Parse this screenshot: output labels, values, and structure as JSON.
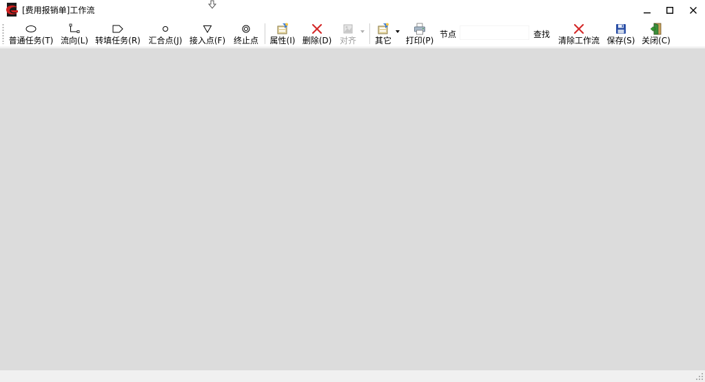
{
  "window": {
    "title": "[费用报销单]工作流",
    "controls": {
      "minimize": "minimize-icon",
      "maximize": "maximize-icon",
      "close": "close-icon"
    }
  },
  "toolbar": {
    "items": [
      {
        "label": "普通任务(T)",
        "icon": "ellipse-icon"
      },
      {
        "label": "流向(L)",
        "icon": "connector-icon"
      },
      {
        "label": "转填任务(R)",
        "icon": "pentagon-tag-icon"
      },
      {
        "label": "汇合点(J)",
        "icon": "small-circle-icon"
      },
      {
        "label": "接入点(F)",
        "icon": "triangle-down-icon"
      },
      {
        "label": "终止点",
        "icon": "double-circle-icon"
      },
      {
        "label": "属性(I)",
        "icon": "properties-icon"
      },
      {
        "label": "删除(D)",
        "icon": "delete-x-icon"
      },
      {
        "label": "对齐",
        "icon": "align-icon",
        "disabled": true
      },
      {
        "label": "其它",
        "icon": "other-icon"
      },
      {
        "label": "打印(P)",
        "icon": "printer-icon"
      },
      {
        "label": "清除工作流",
        "icon": "clear-x-icon"
      },
      {
        "label": "保存(S)",
        "icon": "save-disk-icon"
      },
      {
        "label": "关闭(C)",
        "icon": "exit-door-icon"
      }
    ],
    "node_label": "节点",
    "node_value": "",
    "search_label": "查找"
  },
  "colors": {
    "canvas": "#dcdcdc",
    "delete_red": "#d42a2a",
    "save_blue": "#2b4fa6",
    "logo_red": "#cc1f1f"
  }
}
